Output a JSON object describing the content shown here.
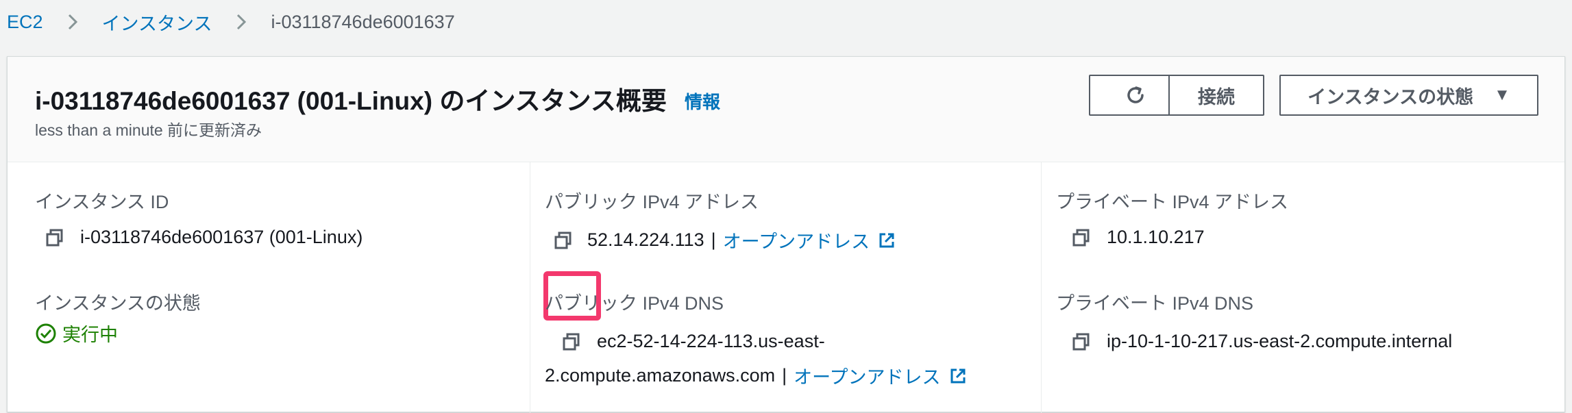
{
  "breadcrumb": {
    "items": [
      "EC2",
      "インスタンス"
    ],
    "current": "i-03118746de6001637"
  },
  "header": {
    "title": "i-03118746de6001637 (001-Linux) のインスタンス概要",
    "info": "情報",
    "subtitle": "less than a minute 前に更新済み",
    "connect_label": "接続",
    "state_label": "インスタンスの状態",
    "state_caret": "▼"
  },
  "col1": {
    "instance_id_label": "インスタンス ID",
    "instance_id_value": "i-03118746de6001637 (001-Linux)",
    "state_label": "インスタンスの状態",
    "state_value": "実行中"
  },
  "col2": {
    "public_ipv4_label": "パブリック IPv4 アドレス",
    "public_ipv4_value": "52.14.224.113",
    "separator": "|",
    "open_address": "オープンアドレス",
    "public_dns_label": "パブリック IPv4 DNS",
    "public_dns_line1": "ec2-52-14-224-113.us-east-",
    "public_dns_line2": "2.compute.amazonaws.com"
  },
  "col3": {
    "private_ipv4_label": "プライベート IPv4 アドレス",
    "private_ipv4_value": "10.1.10.217",
    "private_dns_label": "プライベート IPv4 DNS",
    "private_dns_value": "ip-10-1-10-217.us-east-2.compute.internal"
  },
  "colors": {
    "link": "#0073bb",
    "success": "#1d8102",
    "highlight": "#f3386d"
  },
  "icons": [
    "chevron-right-icon",
    "refresh-icon",
    "copy-icon",
    "external-link-icon",
    "check-circle-icon",
    "caret-down-icon"
  ]
}
